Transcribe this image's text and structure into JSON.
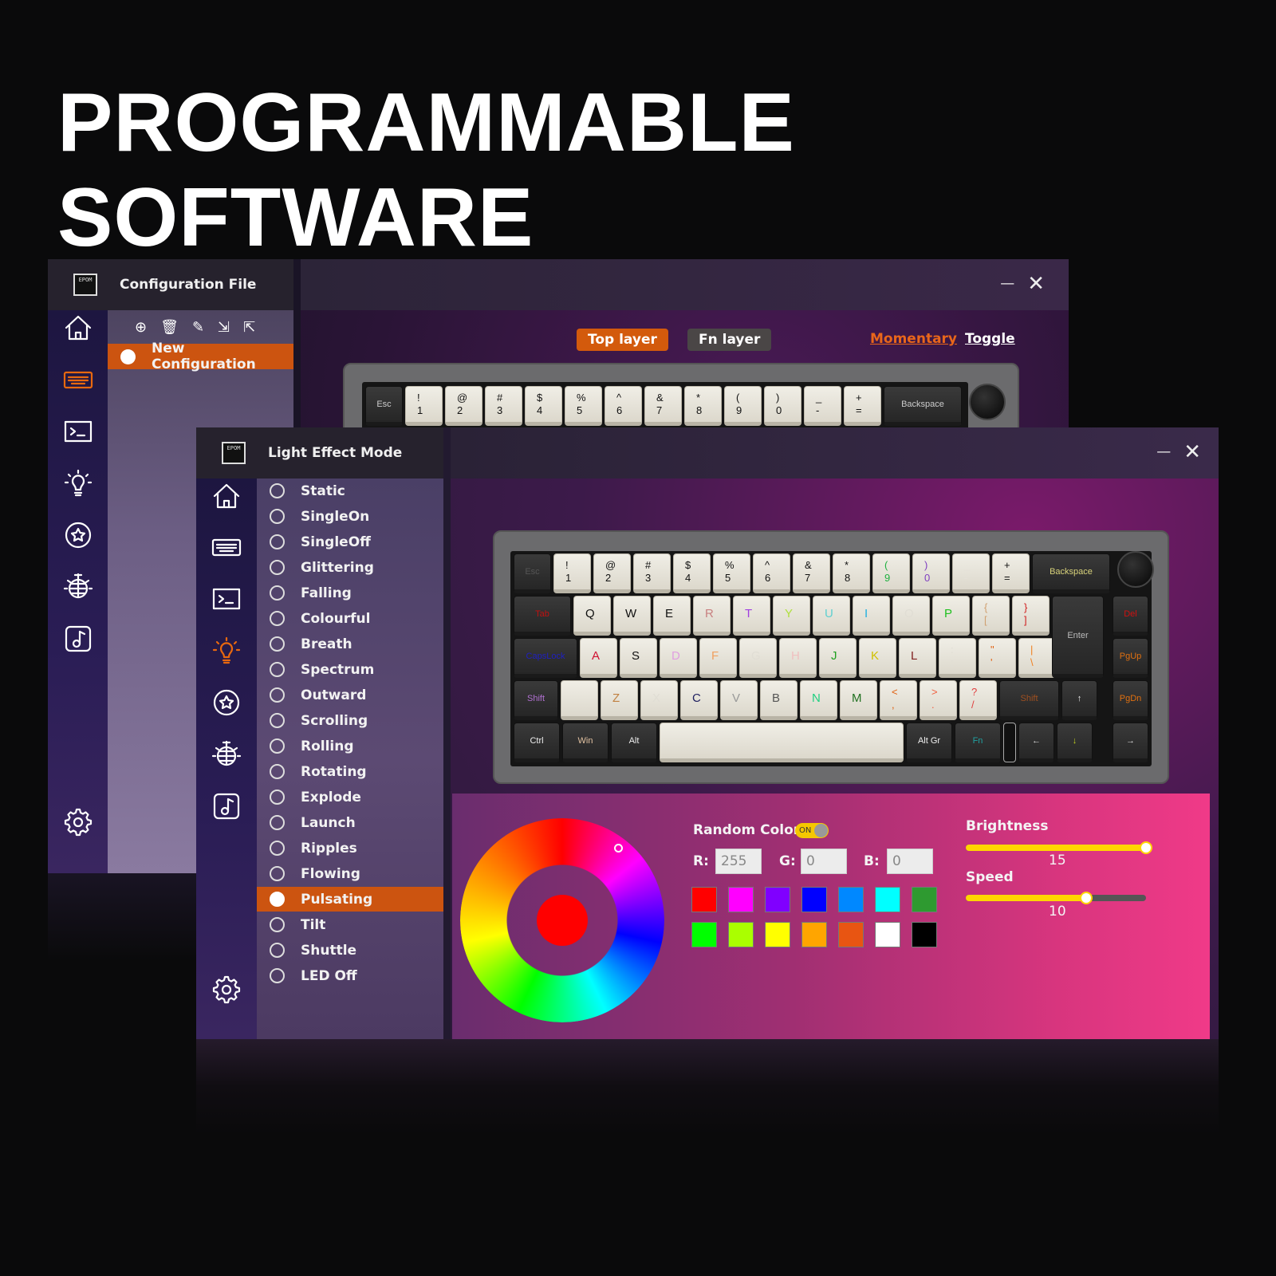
{
  "headline": "PROGRAMMABLE SOFTWARE",
  "back_window": {
    "logo_text": "EPOM",
    "title": "Configuration File",
    "minimize": "—",
    "close": "✕",
    "toolbar_icons": [
      "add-icon",
      "trash-icon",
      "edit-icon",
      "import-icon",
      "export-icon"
    ],
    "config_items": [
      {
        "label": "New Configuration",
        "selected": true
      }
    ],
    "layers": {
      "top": "Top layer",
      "fn": "Fn layer",
      "active": "Top layer"
    },
    "modes": {
      "momentary": "Momentary",
      "toggle": "Toggle"
    },
    "sidebar_icons": [
      "home-icon",
      "keyboard-icon",
      "macro-icon",
      "light-icon",
      "star-icon",
      "disco-icon",
      "music-icon",
      "settings-icon"
    ],
    "active_icon": "keyboard-icon",
    "keyboard_row": [
      {
        "t": "Esc",
        "k": "d"
      },
      {
        "t": "!",
        "b": "1"
      },
      {
        "t": "@",
        "b": "2"
      },
      {
        "t": "#",
        "b": "3"
      },
      {
        "t": "$",
        "b": "4"
      },
      {
        "t": "%",
        "b": "5"
      },
      {
        "t": "^",
        "b": "6"
      },
      {
        "t": "&",
        "b": "7"
      },
      {
        "t": "*",
        "b": "8"
      },
      {
        "t": "(",
        "b": "9"
      },
      {
        "t": ")",
        "b": "0"
      },
      {
        "t": "_",
        "b": "-"
      },
      {
        "t": "+",
        "b": "="
      },
      {
        "t": "Backspace",
        "k": "d"
      }
    ]
  },
  "front_window": {
    "logo_text": "EPOM",
    "title": "Light Effect Mode",
    "minimize": "—",
    "close": "✕",
    "sidebar_icons": [
      "home-icon",
      "keyboard-icon",
      "macro-icon",
      "light-icon",
      "star-icon",
      "disco-icon",
      "music-icon",
      "settings-icon"
    ],
    "active_icon": "light-icon",
    "effects": [
      "Static",
      "SingleOn",
      "SingleOff",
      "Glittering",
      "Falling",
      "Colourful",
      "Breath",
      "Spectrum",
      "Outward",
      "Scrolling",
      "Rolling",
      "Rotating",
      "Explode",
      "Launch",
      "Ripples",
      "Flowing",
      "Pulsating",
      "Tilt",
      "Shuttle",
      "LED Off"
    ],
    "selected_effect": "Pulsating",
    "keyboard": [
      [
        {
          "t": "Esc",
          "k": "d",
          "c": "#555"
        },
        {
          "t": "!",
          "b": "1"
        },
        {
          "t": "@",
          "b": "2"
        },
        {
          "t": "#",
          "b": "3"
        },
        {
          "t": "$",
          "b": "4"
        },
        {
          "t": "%",
          "b": "5"
        },
        {
          "t": "^",
          "b": "6"
        },
        {
          "t": "&",
          "b": "7"
        },
        {
          "t": "*",
          "b": "8"
        },
        {
          "t": "(",
          "b": "9",
          "c": "#20b040"
        },
        {
          "t": ")",
          "b": "0",
          "c": "#8040c0"
        },
        {
          "t": "_",
          "b": "-",
          "c": "#e4e1d8"
        },
        {
          "t": "+",
          "b": "="
        },
        {
          "t": "Backspace",
          "k": "d",
          "c": "#d8d27a"
        }
      ],
      [
        {
          "t": "Tab",
          "k": "d",
          "c": "#c01010"
        },
        {
          "t": "Q"
        },
        {
          "t": "W"
        },
        {
          "t": "E"
        },
        {
          "t": "R",
          "c": "#c88080"
        },
        {
          "t": "T",
          "c": "#a040e0"
        },
        {
          "t": "Y",
          "c": "#b0e040"
        },
        {
          "t": "U",
          "c": "#60d0d0"
        },
        {
          "t": "I",
          "c": "#20b0e0"
        },
        {
          "t": "O",
          "c": "#e0ddd4"
        },
        {
          "t": "P",
          "c": "#20c020"
        },
        {
          "t": "{",
          "b": "[",
          "c": "#d0a070"
        },
        {
          "t": "}",
          "b": "]",
          "c": "#d02020"
        },
        {
          "t": "Enter",
          "k": "d",
          "c": "#bbb"
        },
        {
          "t": "Del",
          "k": "d",
          "c": "#d01010"
        }
      ],
      [
        {
          "t": "CapsLock",
          "k": "d",
          "c": "#2020c0"
        },
        {
          "t": "A",
          "c": "#d01030"
        },
        {
          "t": "S"
        },
        {
          "t": "D",
          "c": "#e0a0e0"
        },
        {
          "t": "F",
          "c": "#f0a060"
        },
        {
          "t": "G",
          "c": "#e0ddd4"
        },
        {
          "t": "H",
          "c": "#f0c0c0"
        },
        {
          "t": "J",
          "c": "#20a020"
        },
        {
          "t": "K",
          "c": "#d0c000"
        },
        {
          "t": "L",
          "c": "#802020"
        },
        {
          "t": ":",
          "b": ";",
          "c": "#e0ddd4"
        },
        {
          "t": "\"",
          "b": "'",
          "c": "#e06010"
        },
        {
          "t": "|",
          "b": "\\",
          "c": "#f08020"
        },
        {
          "t": "PgUp",
          "k": "d",
          "c": "#e07010"
        }
      ],
      [
        {
          "t": "Shift",
          "k": "d",
          "c": "#b070d0"
        },
        {
          "t": "",
          "c": "#e0ddd4"
        },
        {
          "t": "Z",
          "c": "#c08040"
        },
        {
          "t": "X",
          "c": "#e0ddd4"
        },
        {
          "t": "C",
          "c": "#202060"
        },
        {
          "t": "V",
          "c": "#999"
        },
        {
          "t": "B",
          "c": "#555"
        },
        {
          "t": "N",
          "c": "#20d080"
        },
        {
          "t": "M",
          "c": "#207020"
        },
        {
          "t": "<",
          "b": ",",
          "c": "#e06010"
        },
        {
          "t": ">",
          "b": ".",
          "c": "#f06040"
        },
        {
          "t": "?",
          "b": "/",
          "c": "#e04040"
        },
        {
          "t": "Shift",
          "k": "d",
          "c": "#a05020"
        },
        {
          "t": "↑",
          "k": "d",
          "c": "#eee"
        },
        {
          "t": "PgDn",
          "k": "d",
          "c": "#e07010"
        }
      ],
      [
        {
          "t": "Ctrl",
          "k": "d",
          "c": "#eee"
        },
        {
          "t": "Win",
          "k": "d",
          "c": "#e0c0a0"
        },
        {
          "t": "Alt",
          "k": "d",
          "c": "#eee"
        },
        {
          "t": "",
          "k": "l"
        },
        {
          "t": "Alt Gr",
          "k": "d",
          "c": "#eee"
        },
        {
          "t": "Fn",
          "k": "d",
          "c": "#20a0a0"
        },
        {
          "t": "",
          "k": "s"
        },
        {
          "t": "←",
          "k": "d",
          "c": "#ddd"
        },
        {
          "t": "↓",
          "k": "d",
          "c": "#c0d020"
        },
        {
          "t": "→",
          "k": "d",
          "c": "#ddd"
        }
      ]
    ],
    "color_panel": {
      "random_color_label": "Random Color",
      "toggle_text": "ON",
      "random_color_on": true,
      "r_label": "R:",
      "r_value": "255",
      "g_label": "G:",
      "g_value": "0",
      "b_label": "B:",
      "b_value": "0",
      "selected_color": "#ff0000",
      "swatches": [
        "#ff0000",
        "#ff00ff",
        "#8000ff",
        "#0000ff",
        "#0088ff",
        "#00ffff",
        "#2e9a30",
        "#00ff00",
        "#aaff00",
        "#ffff00",
        "#ffa500",
        "#e85512",
        "#ffffff",
        "#000000"
      ],
      "brightness_label": "Brightness",
      "brightness_value": "15",
      "brightness_fraction": 1.0,
      "speed_label": "Speed",
      "speed_value": "10",
      "speed_fraction": 0.67
    }
  },
  "colors": {
    "accent": "#cc5410",
    "slider": "#ffd600"
  }
}
